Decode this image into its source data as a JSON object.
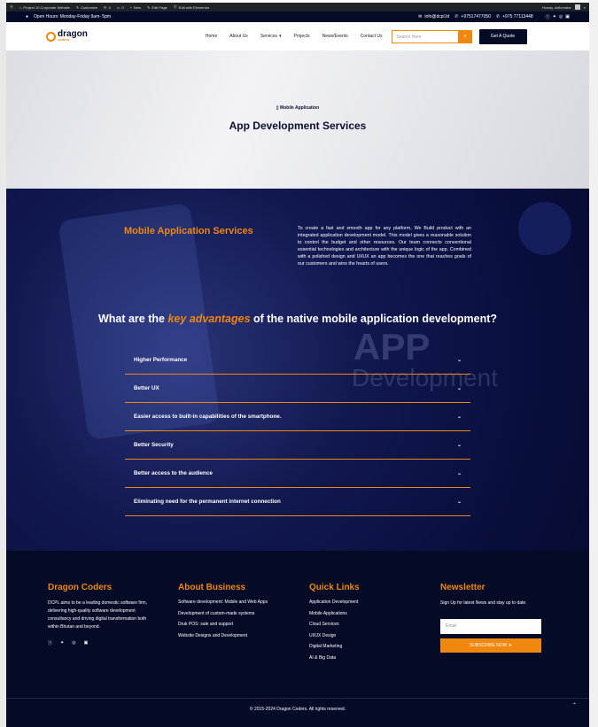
{
  "admin_bar": {
    "items": [
      "Project 10 Corporate Website",
      "Customize",
      "4",
      "0",
      "New",
      "Edit Page",
      "Edit with Elementor"
    ],
    "howdy": "Howdy, dcficreator"
  },
  "info_bar": {
    "hours": "Open Hours: Monday-Friday 9am- 5pm",
    "email": "info@dcpl.bt",
    "phone1": "+97517477050",
    "phone2": "+975 77113448"
  },
  "header": {
    "logo_main": "dragon",
    "logo_sub": "coders",
    "nav": [
      "Home",
      "About Us",
      "Services",
      "Projects",
      "News/Events",
      "Contact Us"
    ],
    "search_placeholder": "Search Here",
    "quote_label": "Get A Quote"
  },
  "hero": {
    "crumb": "Mobile Application",
    "title": "App Development Services"
  },
  "main": {
    "services_title": "Mobile Application Services",
    "services_desc": "To create a fast and smooth app for any platform, We Build product with an integrated application development model. This model gives a reasonable solution to control the budget and other resources. Our team connects conventional essential technologies and architecture with the unique logic of the app. Combined with a polished design and UI/UX an app becomes the one that reaches goals of our customers and wins the hearts of users.",
    "adv_pre": "What are the ",
    "adv_em": "key advantages",
    "adv_post": " of the native mobile application development?",
    "deco_app": "APP",
    "deco_dev": "Development",
    "accordion": [
      "Higher Performance",
      "Better UX",
      "Easier access to built-in capabilities of the smartphone.",
      "Better Security",
      "Better access to the audience",
      "Eliminating need for the permanent internet connection"
    ]
  },
  "footer": {
    "col1_title": "Dragon Coders",
    "col1_text": "DCPL aims to be a leading domestic software firm, delivering high-quality software development consultancy and driving digital transformation both within Bhutan and beyond.",
    "col2_title": "About Business",
    "col2_links": [
      "Software development: Mobile and Web Apps",
      "Development of custom-made systems",
      "Druk POS: sale and support",
      "Website Designs and Development"
    ],
    "col3_title": "Quick Links",
    "col3_links": [
      "Application Development",
      "Mobile Applications",
      "Cloud Services",
      "UI/UX Design",
      "Digital Marketing",
      "AI & Big Data"
    ],
    "col4_title": "Newsletter",
    "col4_text": "Sign Up for latest News and stay up to date.",
    "email_placeholder": "Email",
    "subscribe_label": "SUBSCRIBE NOW",
    "copyright": "© 2015-2024 Dragon Coders. All rights reserved."
  },
  "colors": {
    "accent": "#f0870e",
    "navy": "#040b27"
  }
}
